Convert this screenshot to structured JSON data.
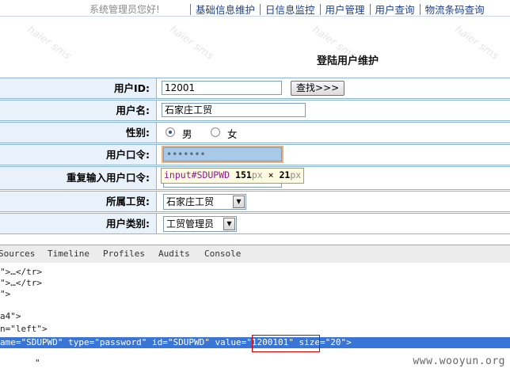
{
  "nav": {
    "greeting": "系统管理员您好!",
    "items": [
      "基础信息维护",
      "日信息监控",
      "用户管理",
      "用户查询",
      "物流条码查询"
    ]
  },
  "watermark": "haier sms",
  "page_title": "登陆用户维护",
  "form": {
    "user_id_label": "用户ID:",
    "user_id_value": "12001",
    "find_button": "查找>>>",
    "username_label": "用户名:",
    "username_value": "石家庄工贸",
    "gender_label": "性别:",
    "gender_male": "男",
    "gender_female": "女",
    "gender_selected": "男",
    "password_label": "用户口令:",
    "password_value": "•••••••",
    "repeat_password_label": "重复输入用户口令:",
    "factory_label": "所属工贸:",
    "factory_value": "石家庄工贸",
    "user_type_label": "用户类别:",
    "user_type_value": "工贸管理员"
  },
  "tooltip": {
    "selector": "input#SDUPWD",
    "width": "151",
    "times": "×",
    "height": "21",
    "unit": "px"
  },
  "devtools": {
    "tabs": [
      "Sources",
      "Timeline",
      "Profiles",
      "Audits",
      "Console"
    ],
    "lines": [
      "\">…</tr>",
      "\">…</tr>",
      "\">",
      "",
      "a4\">",
      "n=\"left\">",
      "",
      "\""
    ],
    "selected_line": "ame=\"SDUPWD\" type=\"password\" id=\"SDUPWD\" value=\"1200101\" size=\"20\">",
    "highlight_value": "value=\"1200101\""
  },
  "footer_watermark": "www.wooyun.org",
  "colors": {
    "nav_link": "#1c3f8c",
    "label_bg": "#e9f2fb",
    "border": "#8fb5d6",
    "selection": "#3875d7",
    "highlight_box": "#d40000"
  }
}
